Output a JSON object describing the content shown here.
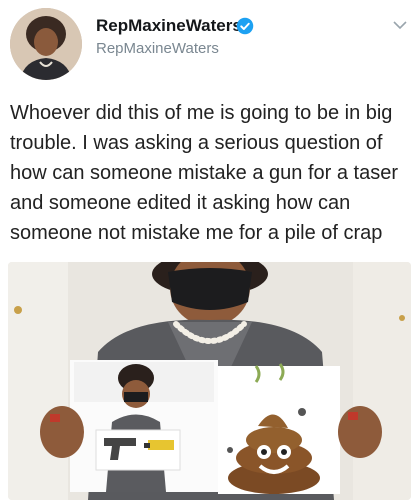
{
  "tweet": {
    "display_name": "RepMaxineWaters",
    "handle": "RepMaxineWaters",
    "verified": true,
    "text": "Whoever did this of me is going to be in big\ntrouble. I was asking a serious question of\nhow can someone mistake a gun for a taser\nand someone edited it asking how can\nsomeone not mistake me for a pile of crap"
  },
  "icons": {
    "verified": "verified-badge-icon",
    "menu": "chevron-down-icon"
  },
  "colors": {
    "verified_blue": "#1da1f2",
    "handle_gray": "#7a8791",
    "text": "#222222"
  }
}
